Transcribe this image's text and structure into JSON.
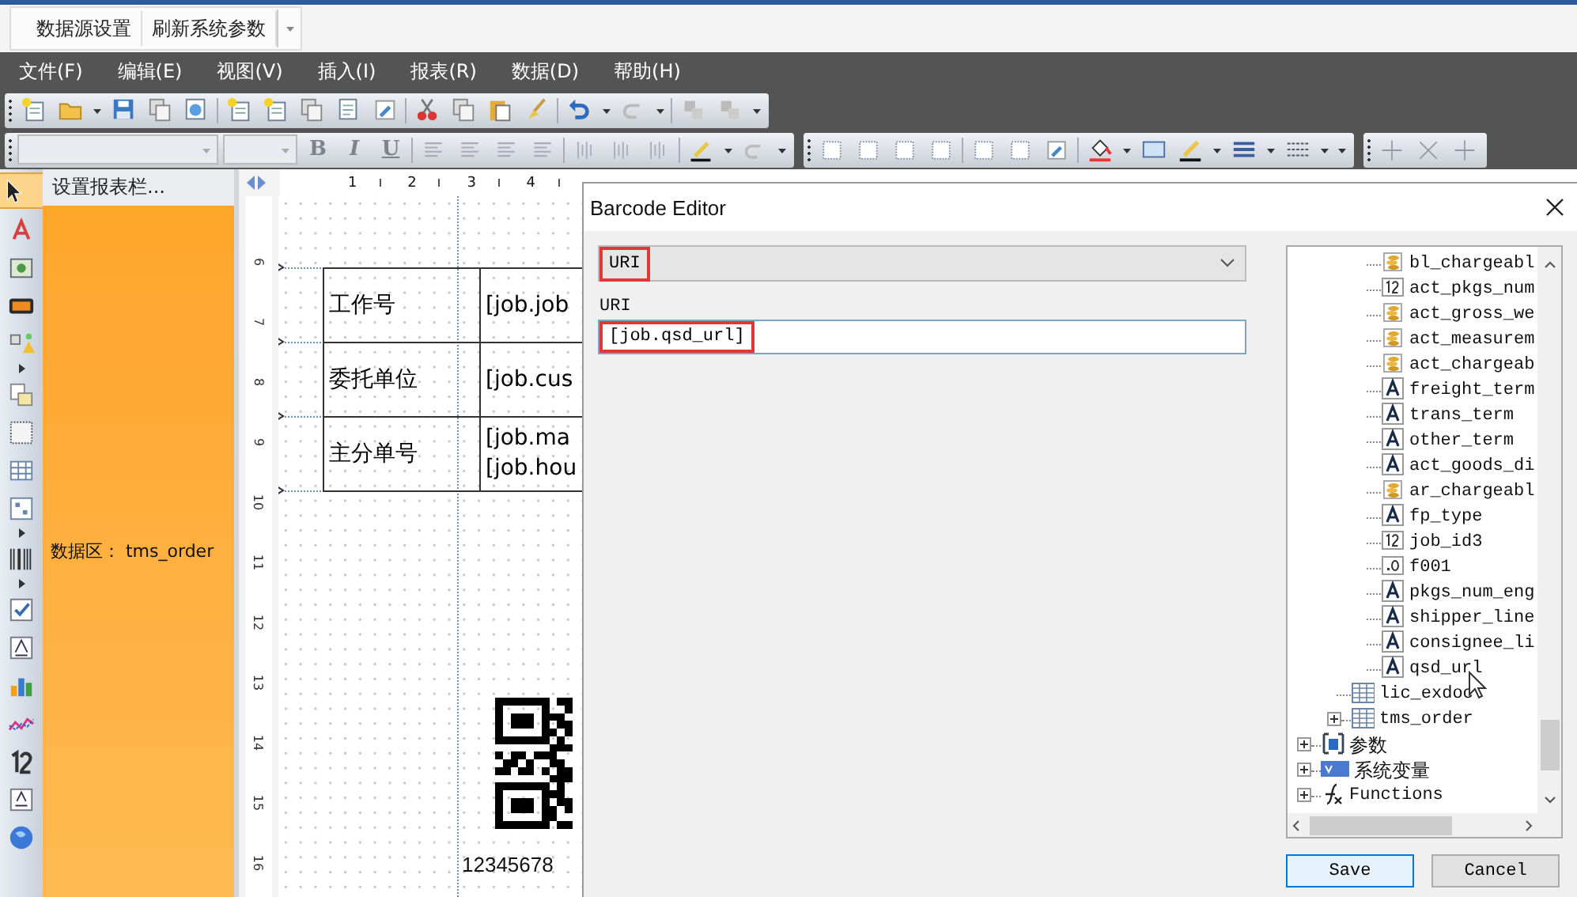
{
  "quick_toolbar": {
    "buttons": [
      "数据源设置",
      "刷新系统参数"
    ]
  },
  "menu_bar": [
    "文件(F)",
    "编辑(E)",
    "视图(V)",
    "插入(I)",
    "报表(R)",
    "数据(D)",
    "帮助(H)"
  ],
  "format_toolbar": {
    "buttons": [
      {
        "label": "B",
        "disabled": true
      },
      {
        "label": "I",
        "disabled": true
      },
      {
        "label": "U",
        "disabled": true
      }
    ]
  },
  "band_panel": {
    "header": "设置报表栏...",
    "band_label": "数据区： tms_order"
  },
  "ruler": {
    "horizontal": [
      "1",
      "2",
      "3",
      "4"
    ],
    "vertical": [
      "6",
      "7",
      "8",
      "9",
      "10",
      "11",
      "12",
      "13",
      "14",
      "15",
      "16"
    ]
  },
  "report": {
    "rows": [
      {
        "label": "工作号",
        "value": [
          "[job.job"
        ]
      },
      {
        "label": "委托单位",
        "value": [
          "[job.cus"
        ]
      },
      {
        "label": "主分单号",
        "value": [
          "[job.ma",
          "[job.hou"
        ]
      }
    ],
    "barcode_caption": "12345678"
  },
  "dialog": {
    "title": "Barcode Editor",
    "type_select": {
      "value": "URI",
      "highlighted": true
    },
    "field_label": "URI",
    "field": {
      "value": "[job.qsd_url]",
      "highlighted": true
    },
    "tree": [
      {
        "children": [
          {
            "children": [
              {
                "label": "bl_chargeabl",
                "kind": "decimal"
              },
              {
                "label": "act_pkgs_num",
                "kind": "integer"
              },
              {
                "label": "act_gross_we",
                "kind": "decimal"
              },
              {
                "label": "act_measurem",
                "kind": "decimal"
              },
              {
                "label": "act_chargeab",
                "kind": "decimal"
              },
              {
                "label": "freight_term",
                "kind": "text"
              },
              {
                "label": "trans_term",
                "kind": "text"
              },
              {
                "label": "other_term",
                "kind": "text"
              },
              {
                "label": "act_goods_di",
                "kind": "text"
              },
              {
                "label": "ar_chargeabl",
                "kind": "decimal"
              },
              {
                "label": "fp_type",
                "kind": "text"
              },
              {
                "label": "job_id3",
                "kind": "integer"
              },
              {
                "label": "f001",
                "kind": "float"
              },
              {
                "label": "pkgs_num_eng",
                "kind": "text"
              },
              {
                "label": "shipper_line",
                "kind": "text"
              },
              {
                "label": "consignee_li",
                "kind": "text"
              },
              {
                "label": "qsd_url",
                "kind": "text"
              }
            ]
          },
          {
            "label": "lic_exdoc",
            "kind": "table"
          },
          {
            "label": "tms_order",
            "kind": "table",
            "expanded": false
          }
        ]
      },
      {
        "label": "参数",
        "kind": "param",
        "expanded": false
      },
      {
        "label": "系统变量",
        "kind": "variable",
        "expanded": false
      },
      {
        "label": "Functions",
        "kind": "function",
        "expanded": false
      }
    ],
    "buttons": [
      {
        "label": "Save",
        "default": true
      },
      {
        "label": "Cancel",
        "default": false
      }
    ]
  }
}
